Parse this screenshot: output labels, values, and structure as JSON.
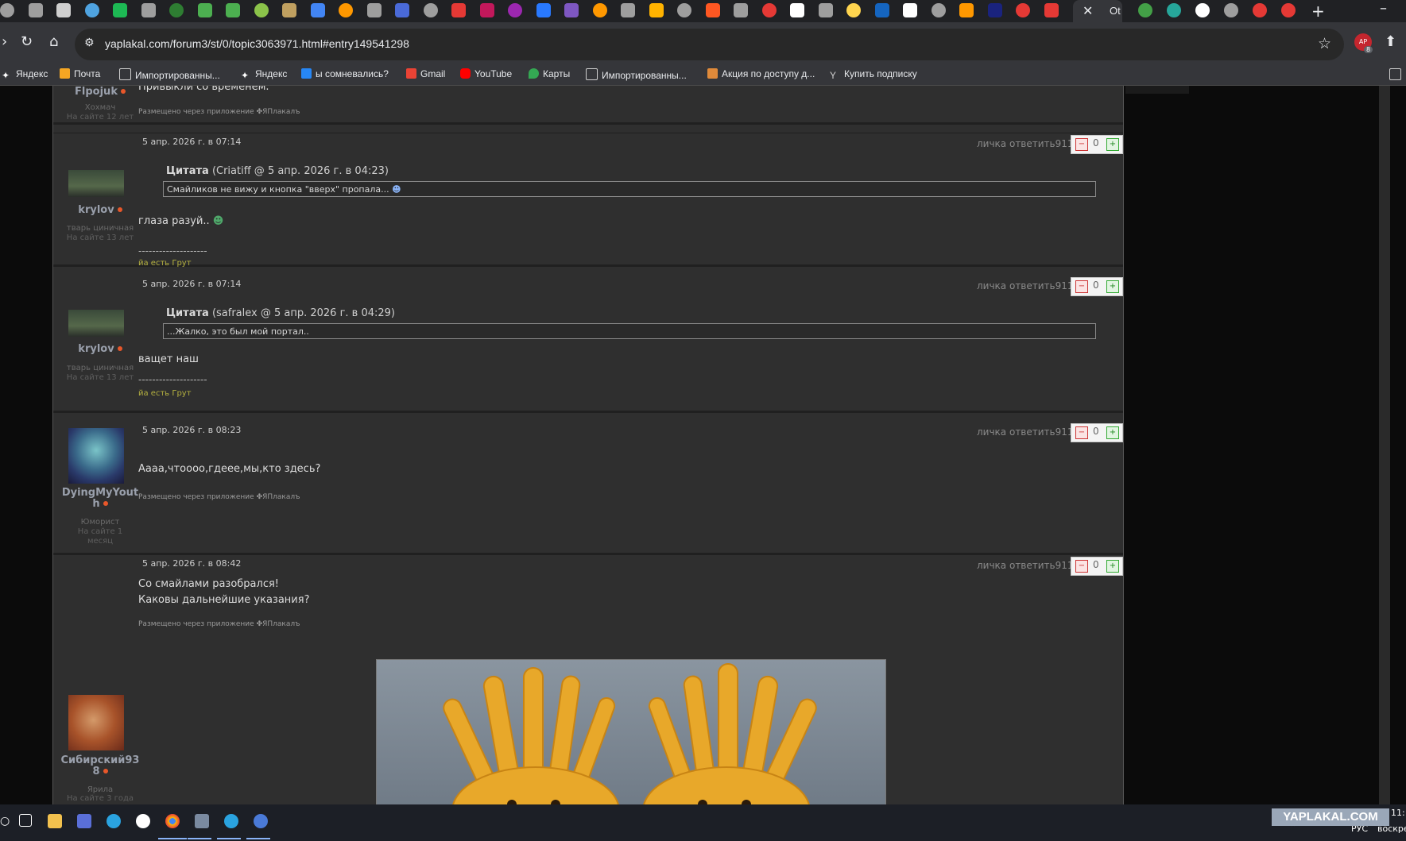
{
  "browser": {
    "active_tab_partial_title": "Ot",
    "new_tab_label": "+",
    "url": "yaplakal.com/forum3/st/0/topic3063971.html#entry149541298",
    "profile_badge": "8",
    "profile_label": "AP"
  },
  "bookmarks": [
    {
      "label": "Яндекс",
      "icon": "yandex-star-icon",
      "color": "#ffffff"
    },
    {
      "label": "Почта",
      "icon": "mail-icon",
      "color": "#f5a623"
    },
    {
      "label": "Импортированны...",
      "icon": "folder-icon",
      "color": "#cfcfcf"
    },
    {
      "label": "Яндекс",
      "icon": "yandex-star-icon",
      "color": "#ffffff"
    },
    {
      "label": "ы сомневались?",
      "icon": "vk-icon",
      "color": "#2787f5"
    },
    {
      "label": "Gmail",
      "icon": "gmail-icon",
      "color": "#ea4335"
    },
    {
      "label": "YouTube",
      "icon": "youtube-icon",
      "color": "#ff0000"
    },
    {
      "label": "Карты",
      "icon": "maps-pin-icon",
      "color": "#34a853"
    },
    {
      "label": "Импортированны...",
      "icon": "folder-icon",
      "color": "#cfcfcf"
    },
    {
      "label": "Акция по доступу д...",
      "icon": "promo-icon",
      "color": "#e08a3a"
    },
    {
      "label": "Купить подписку",
      "icon": "ya-icon",
      "color": "#cfcfcf"
    }
  ],
  "posts": [
    {
      "author": "Flpojuk",
      "rank": "Хохмач",
      "tenure": "На сайте 12 лет",
      "text": "Привыкли со временем.",
      "via_app": "Размещено через приложение",
      "app_name": "ЯПлакалъ"
    },
    {
      "date": "5 апр. 2026 г. в 07:14",
      "actions": "личка ответить911",
      "votes": "0",
      "author": "krylov",
      "rank": "тварь циничная",
      "tenure": "На сайте 13 лет",
      "quote_label": "Цитата",
      "quote_meta": "(Criatiff @ 5 апр. 2026 г. в 04:23)",
      "quote_text": "Смайликов не вижу и кнопка \"вверх\" пропала...",
      "text": "глаза разуй..",
      "sig_line": "--------------------",
      "signature": "йа есть Грут"
    },
    {
      "date": "5 апр. 2026 г. в 07:14",
      "actions": "личка ответить911",
      "votes": "0",
      "author": "krylov",
      "rank": "тварь циничная",
      "tenure": "На сайте 13 лет",
      "quote_label": "Цитата",
      "quote_meta": "(safralex @ 5 апр. 2026 г. в 04:29)",
      "quote_text": "...Жалко, это был мой портал..",
      "text": "ващет наш",
      "sig_line": "--------------------",
      "signature": "йа есть Грут"
    },
    {
      "date": "5 апр. 2026 г. в 08:23",
      "actions": "личка ответить911",
      "votes": "0",
      "author_line1": "DyingMyYout",
      "author_line2": "h",
      "rank": "Юморист",
      "tenure_line1": "На сайте 1",
      "tenure_line2": "месяц",
      "text": "Аааа,чтoooo,гдеее,мы,кто здесь?",
      "via_app": "Размещено через приложение",
      "app_name": "ЯПлакалъ"
    },
    {
      "date": "5 апр. 2026 г. в 08:42",
      "actions": "личка ответить911",
      "votes": "0",
      "author_line1": "Сибирский93",
      "author_line2": "8",
      "rank": "Ярила",
      "tenure": "На сайте 3 года",
      "text_line1": "Со смайлами разобрался!",
      "text_line2": "Каковы дальнейшие указания?",
      "via_app": "Размещено через приложение",
      "app_name": "ЯПлакалъ"
    }
  ],
  "taskbar": {
    "lang": "РУС",
    "day_partial": "воскре",
    "time_partial": "11:"
  },
  "watermark": "YAPLAKAL.COM",
  "colors": {
    "page_bg": "#2f2f2f",
    "online_dot": "#e8572a",
    "signature": "#b4b040",
    "vote_minus": "#cc3333",
    "vote_plus": "#228822"
  }
}
